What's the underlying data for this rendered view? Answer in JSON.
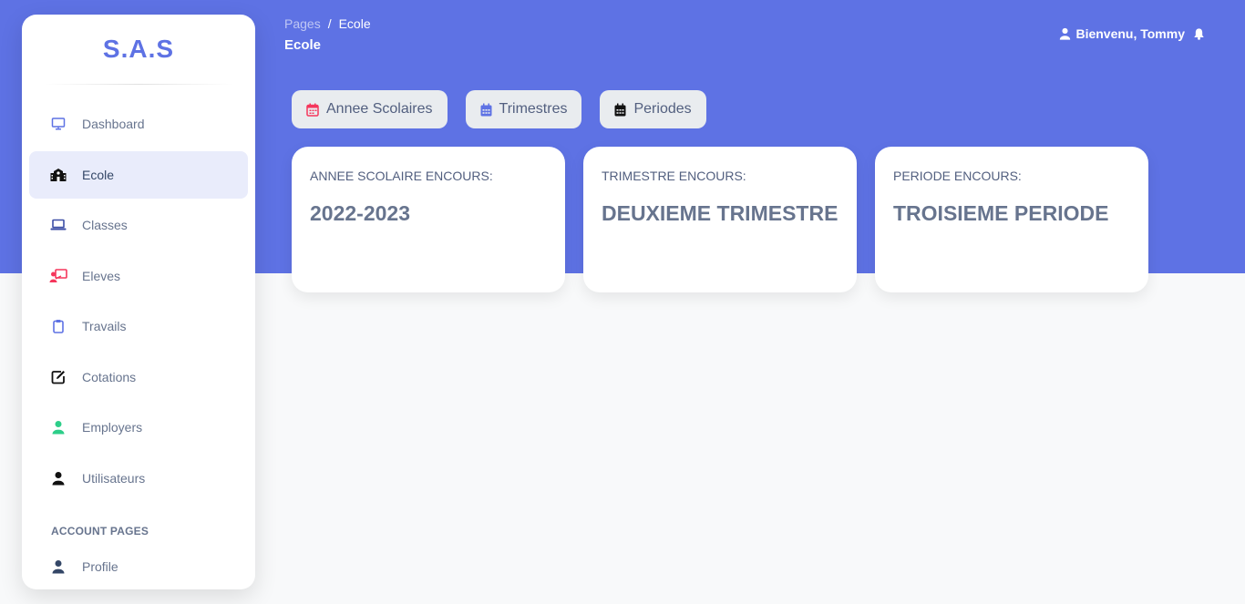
{
  "brand": {
    "name": "S.A.S"
  },
  "colors": {
    "accent": "#5e72e4",
    "background": "#f8f9fa",
    "active_bg": "#e9ecfb"
  },
  "sidebar": {
    "items": [
      {
        "label": "Dashboard",
        "icon": "desktop-icon",
        "active": false
      },
      {
        "label": "Ecole",
        "icon": "school-icon",
        "active": true
      },
      {
        "label": "Classes",
        "icon": "laptop-icon",
        "active": false
      },
      {
        "label": "Eleves",
        "icon": "teacher-board-icon",
        "active": false
      },
      {
        "label": "Travails",
        "icon": "clipboard-icon",
        "active": false
      },
      {
        "label": "Cotations",
        "icon": "edit-icon",
        "active": false
      },
      {
        "label": "Employers",
        "icon": "user-icon",
        "active": false
      },
      {
        "label": "Utilisateurs",
        "icon": "user-icon",
        "active": false
      }
    ],
    "section_title": "ACCOUNT PAGES",
    "account_items": [
      {
        "label": "Profile",
        "icon": "user-icon"
      }
    ]
  },
  "header": {
    "breadcrumb": {
      "root": "Pages",
      "separator": "/",
      "current": "Ecole"
    },
    "title": "Ecole",
    "user_greeting": "Bienvenu, Tommy"
  },
  "tabs": [
    {
      "label": "Annee Scolaires",
      "icon": "calendar-alt-icon"
    },
    {
      "label": "Trimestres",
      "icon": "calendar-icon"
    },
    {
      "label": "Periodes",
      "icon": "calendar-days-icon"
    }
  ],
  "cards": [
    {
      "label": "ANNEE SCOLAIRE ENCOURS:",
      "value": "2022-2023"
    },
    {
      "label": "TRIMESTRE ENCOURS:",
      "value": "DEUXIEME TRIMESTRE"
    },
    {
      "label": "PERIODE ENCOURS:",
      "value": "TROISIEME PERIODE"
    }
  ]
}
